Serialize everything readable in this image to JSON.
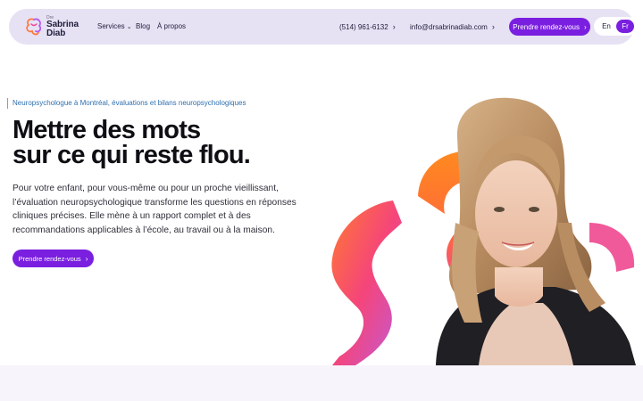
{
  "brand": {
    "prefix": "Dre",
    "name_line1": "Sabrina",
    "name_line2": "Diab"
  },
  "nav": {
    "services": "Services",
    "blog": "Blog",
    "about": "À propos",
    "phone": "(514) 961-6132",
    "email": "info@drsabrinadiab.com",
    "cta": "Prendre rendez-vous",
    "lang_en": "En",
    "lang_fr": "Fr",
    "active_lang": "Fr"
  },
  "hero": {
    "eyebrow": "Neuropsychologue à Montréal, évaluations et bilans neuropsychologiques",
    "headline_line1": "Mettre des mots",
    "headline_line2": "sur ce qui reste flou.",
    "body_line1": "Pour votre enfant, pour vous-même ou pour un proche vieillissant,",
    "body_line2": "l’évaluation neuropsychologique transforme les questions en réponses",
    "body_line3": "cliniques précises. Elle mène à un rapport complet et à des",
    "body_line4": "recommandations applicables à l’école, au travail ou à la maison.",
    "cta": "Prendre rendez-vous"
  },
  "icons": {
    "logo": "brain-logo-icon",
    "services_chevron": "chevron-down-icon",
    "arrow": "chevron-right-icon"
  },
  "colors": {
    "nav_bg": "#e7e1f4",
    "accent": "#7a1fe0",
    "eyebrow": "#2f6fae",
    "shape_orange": "#ff8a1e",
    "shape_pink": "#f0458f"
  }
}
